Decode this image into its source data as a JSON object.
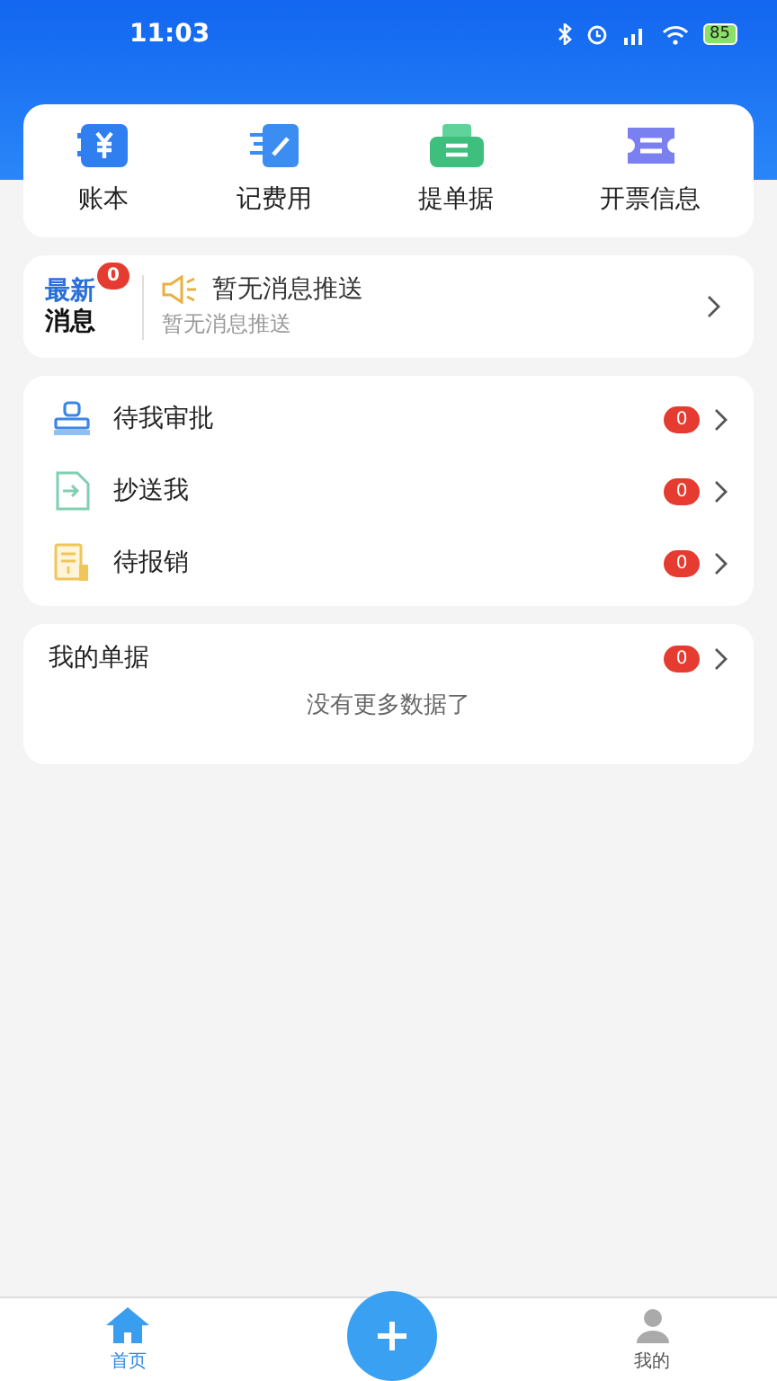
{
  "status_bar": {
    "time": "11:03",
    "battery": "85"
  },
  "quick_actions": [
    {
      "label": "账本"
    },
    {
      "label": "记费用"
    },
    {
      "label": "提单据"
    },
    {
      "label": "开票信息"
    }
  ],
  "news": {
    "logo_top": "最新",
    "logo_bottom": "消息",
    "badge": "0",
    "title": "暂无消息推送",
    "subtitle": "暂无消息推送"
  },
  "tasks": [
    {
      "label": "待我审批",
      "count": "0"
    },
    {
      "label": "抄送我",
      "count": "0"
    },
    {
      "label": "待报销",
      "count": "0"
    }
  ],
  "my_documents": {
    "title": "我的单据",
    "count": "0",
    "empty_text": "没有更多数据了"
  },
  "tab_bar": [
    {
      "label": "首页",
      "selected": true
    },
    {
      "label": "我的",
      "selected": false
    }
  ]
}
